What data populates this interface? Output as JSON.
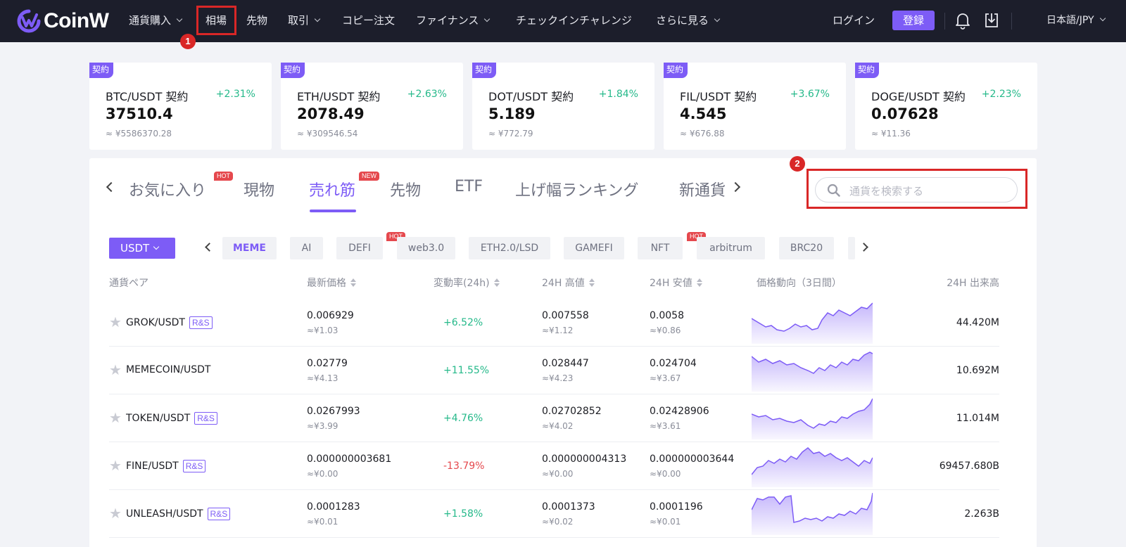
{
  "brand": "CoinW",
  "nav": {
    "items": [
      {
        "label": "通貨購入",
        "dropdown": true
      },
      {
        "label": "相場",
        "dropdown": false
      },
      {
        "label": "先物",
        "dropdown": false
      },
      {
        "label": "取引",
        "dropdown": true
      },
      {
        "label": "コピー注文",
        "dropdown": false
      },
      {
        "label": "ファイナンス",
        "dropdown": true
      },
      {
        "label": "チェックインチャレンジ",
        "dropdown": false
      },
      {
        "label": "さらに見る",
        "dropdown": true
      }
    ],
    "login": "ログイン",
    "register": "登録",
    "language": "日本語/JPY"
  },
  "annotations": {
    "marker1": "1",
    "marker2": "2",
    "color": "#d92727"
  },
  "tickers": [
    {
      "tag": "契約",
      "pair": "BTC/USDT 契約",
      "change": "+2.31%",
      "price": "37510.4",
      "fiat": "≈ ¥5586370.28"
    },
    {
      "tag": "契約",
      "pair": "ETH/USDT 契約",
      "change": "+2.63%",
      "price": "2078.49",
      "fiat": "≈ ¥309546.54"
    },
    {
      "tag": "契約",
      "pair": "DOT/USDT 契約",
      "change": "+1.84%",
      "price": "5.189",
      "fiat": "≈ ¥772.79"
    },
    {
      "tag": "契約",
      "pair": "FIL/USDT 契約",
      "change": "+3.67%",
      "price": "4.545",
      "fiat": "≈ ¥676.88"
    },
    {
      "tag": "契約",
      "pair": "DOGE/USDT 契約",
      "change": "+2.23%",
      "price": "0.07628",
      "fiat": "≈ ¥11.36"
    }
  ],
  "tabs": [
    {
      "label": "お気に入り",
      "badge": "HOT"
    },
    {
      "label": "現物",
      "badge": ""
    },
    {
      "label": "売れ筋",
      "badge": "NEW",
      "active": true
    },
    {
      "label": "先物",
      "badge": ""
    },
    {
      "label": "ETF",
      "badge": ""
    },
    {
      "label": "上げ幅ランキング",
      "badge": ""
    },
    {
      "label": "新通貨",
      "badge": ""
    }
  ],
  "search": {
    "placeholder": "通貨を検索する"
  },
  "quote_select": "USDT",
  "categories": [
    {
      "label": "MEME",
      "active": true,
      "badge": ""
    },
    {
      "label": "AI",
      "badge": ""
    },
    {
      "label": "DEFI",
      "badge": "HOT"
    },
    {
      "label": "web3.0",
      "badge": ""
    },
    {
      "label": "ETH2.0/LSD",
      "badge": ""
    },
    {
      "label": "GAMEFI",
      "badge": ""
    },
    {
      "label": "NFT",
      "badge": "HOT"
    },
    {
      "label": "arbitrum",
      "badge": ""
    },
    {
      "label": "BRC20",
      "badge": ""
    }
  ],
  "table": {
    "headers": {
      "pair": "通貨ペア",
      "price": "最新価格",
      "change": "変動率(24h)",
      "high": "24H 高値",
      "low": "24H 安値",
      "trend": "価格動向（3日間）",
      "volume": "24H 出来高"
    },
    "rows": [
      {
        "pair": "GROK/USDT",
        "rs": "R&S",
        "price": "0.006929",
        "price_fiat": "≈¥1.03",
        "change": "+6.52%",
        "dir": "up",
        "high": "0.007558",
        "high_fiat": "≈¥1.12",
        "low": "0.0058",
        "low_fiat": "≈¥0.86",
        "volume": "44.420M"
      },
      {
        "pair": "MEMECOIN/USDT",
        "rs": "",
        "price": "0.02779",
        "price_fiat": "≈¥4.13",
        "change": "+11.55%",
        "dir": "up",
        "high": "0.028447",
        "high_fiat": "≈¥4.23",
        "low": "0.024704",
        "low_fiat": "≈¥3.67",
        "volume": "10.692M"
      },
      {
        "pair": "TOKEN/USDT",
        "rs": "R&S",
        "price": "0.0267993",
        "price_fiat": "≈¥3.99",
        "change": "+4.76%",
        "dir": "up",
        "high": "0.02702852",
        "high_fiat": "≈¥4.02",
        "low": "0.02428906",
        "low_fiat": "≈¥3.61",
        "volume": "11.014M"
      },
      {
        "pair": "FINE/USDT",
        "rs": "R&S",
        "price": "0.000000003681",
        "price_fiat": "≈¥0.00",
        "change": "-13.79%",
        "dir": "down",
        "high": "0.000000004313",
        "high_fiat": "≈¥0.00",
        "low": "0.000000003644",
        "low_fiat": "≈¥0.00",
        "volume": "69457.680B"
      },
      {
        "pair": "UNLEASH/USDT",
        "rs": "R&S",
        "price": "0.0001283",
        "price_fiat": "≈¥0.01",
        "change": "+1.58%",
        "dir": "up",
        "high": "0.0001373",
        "high_fiat": "≈¥0.02",
        "low": "0.0001196",
        "low_fiat": "≈¥0.01",
        "volume": "2.263B"
      }
    ]
  },
  "colors": {
    "accent": "#7d5cf6",
    "up": "#25b98a",
    "down": "#e5484d",
    "nav_bg": "#1c1e2b"
  },
  "icons": [
    "coinw-logo-icon",
    "bell-icon",
    "download-icon",
    "search-icon",
    "star-icon",
    "chevron-left-icon",
    "chevron-right-icon"
  ]
}
